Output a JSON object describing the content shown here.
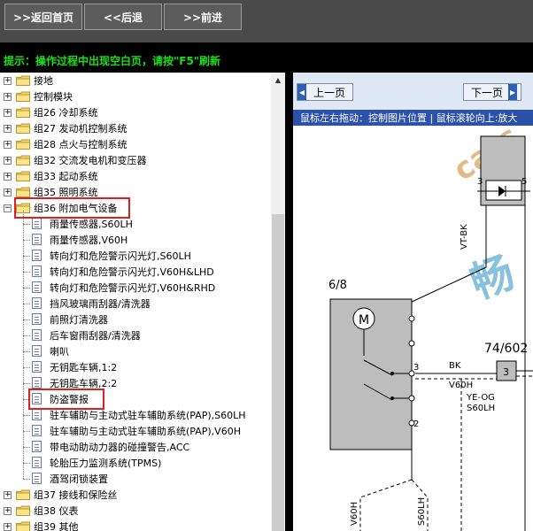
{
  "nav": {
    "home": ">>返回首页",
    "back": "<<后退",
    "forward": ">>前进"
  },
  "hint": "提示：操作过程中出现空白页，请按\"F5\"刷新",
  "tree": {
    "groups_top": [
      {
        "label": "接地"
      },
      {
        "label": "控制模块"
      },
      {
        "label": "组26 冷却系统"
      },
      {
        "label": "组27 发动机控制系统"
      },
      {
        "label": "组28 点火与控制系统"
      },
      {
        "label": "组32 交流发电机和变压器"
      },
      {
        "label": "组33 起动系统"
      },
      {
        "label": "组35 照明系统"
      }
    ],
    "expanded_group": {
      "label": "组36 附加电气设备"
    },
    "items": [
      {
        "label": "雨量传感器,S60LH"
      },
      {
        "label": "雨量传感器,V60H"
      },
      {
        "label": "转向灯和危险警示闪光灯,S60LH"
      },
      {
        "label": "转向灯和危险警示闪光灯,V60H&LHD"
      },
      {
        "label": "转向灯和危险警示闪光灯,V60H&RHD"
      },
      {
        "label": "挡风玻璃雨刮器/清洗器"
      },
      {
        "label": "前照灯清洗器"
      },
      {
        "label": "后车窗雨刮器/清洗器"
      },
      {
        "label": "喇叭"
      },
      {
        "label": "无钥匙车辆,1:2"
      },
      {
        "label": "无钥匙车辆,2:2"
      },
      {
        "label": "防盗警报"
      },
      {
        "label": "驻车辅助与主动式驻车辅助系统(PAP),S60LH"
      },
      {
        "label": "驻车辅助与主动式驻车辅助系统(PAP),V60H"
      },
      {
        "label": "带电动助动力器的碰撞警告,ACC"
      },
      {
        "label": "轮胎压力监测系统(TPMS)"
      },
      {
        "label": "酒驾闭锁装置"
      }
    ],
    "groups_bottom": [
      {
        "label": "组37 接线和保险丝"
      },
      {
        "label": "组38 仪表"
      },
      {
        "label": "组39 其他"
      }
    ]
  },
  "viewer": {
    "prev": "上一页",
    "next": "下一页",
    "tip": "鼠标左右拖动：控制图片位置 | 鼠标滚轮向上:放大",
    "diagram": {
      "connector1": "6/8",
      "connector2": "74/602",
      "pin3a": "3",
      "pin5": "5",
      "pin3b": "3",
      "pin3c": "3",
      "pin2": "2",
      "wire_vtbk": "VT-BK",
      "wire_bk": "BK",
      "wire_v60h_a": "V60H",
      "wire_yeog": "YE-OG",
      "wire_s60lh_a": "S60LH",
      "wire_v60h_b": "V60H",
      "wire_s60lh_b": "S60LH",
      "motor": "M",
      "watermark1": "cars",
      "watermark2": "畅"
    }
  },
  "colors": {
    "hint": "#19e019",
    "highlight": "#e02020",
    "tipbar": "#2b52a8"
  }
}
